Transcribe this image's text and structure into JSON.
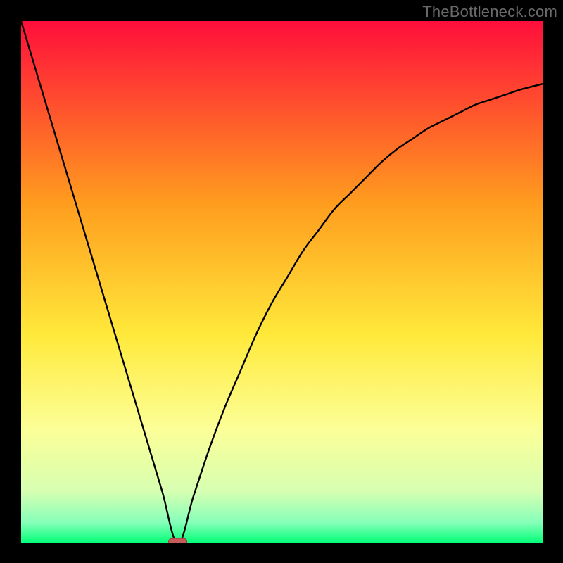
{
  "watermark": "TheBottleneck.com",
  "colors": {
    "gradient_top": "#ff0e3b",
    "gradient_mid1": "#ff9d1e",
    "gradient_mid2": "#ffe93a",
    "gradient_mid3": "#fcff97",
    "gradient_low1": "#d7ffb1",
    "gradient_low2": "#86ffb9",
    "gradient_bottom": "#00ff76",
    "curve": "#000000",
    "marker_fill": "#c85a5a",
    "marker_stroke": "#9c3a3a",
    "frame": "#000000"
  },
  "chart_data": {
    "type": "line",
    "title": "",
    "xlabel": "",
    "ylabel": "",
    "xlim": [
      0,
      100
    ],
    "ylim": [
      0,
      100
    ],
    "grid": false,
    "optimum_x": 30,
    "marker": {
      "x": 30,
      "y": 0
    },
    "series": [
      {
        "name": "bottleneck-curve",
        "x": [
          0,
          3,
          6,
          9,
          12,
          15,
          18,
          21,
          24,
          27,
          30,
          33,
          36,
          39,
          42,
          45,
          48,
          51,
          54,
          57,
          60,
          63,
          66,
          69,
          72,
          75,
          78,
          81,
          84,
          87,
          90,
          93,
          96,
          100
        ],
        "y": [
          100,
          90,
          80,
          70,
          60,
          50,
          40,
          30,
          20,
          10,
          0,
          9,
          18,
          26,
          33,
          40,
          46,
          51,
          56,
          60,
          64,
          67,
          70,
          73,
          75.5,
          77.5,
          79.5,
          81,
          82.5,
          84,
          85,
          86,
          87,
          88
        ]
      }
    ],
    "annotations": []
  }
}
